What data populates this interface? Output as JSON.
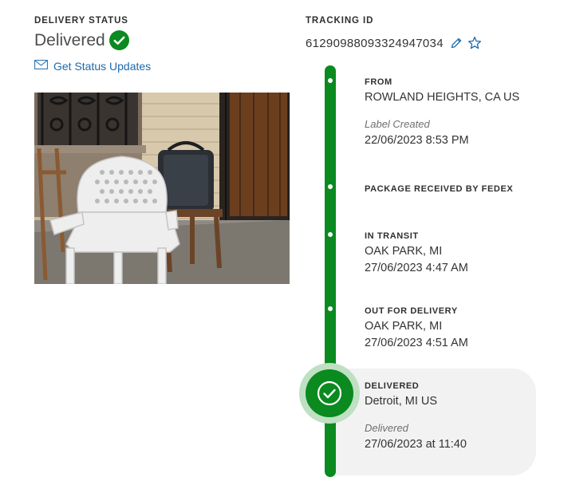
{
  "delivery_status": {
    "heading": "DELIVERY STATUS",
    "status": "Delivered",
    "updates_link": "Get Status Updates"
  },
  "tracking": {
    "heading": "TRACKING ID",
    "number": "61290988093324947034"
  },
  "timeline": {
    "from": {
      "title": "FROM",
      "location": "ROWLAND HEIGHTS, CA US",
      "note": "Label Created",
      "datetime": "22/06/2023 8:53 PM"
    },
    "received": {
      "title": "PACKAGE RECEIVED BY FEDEX"
    },
    "in_transit": {
      "title": "IN TRANSIT",
      "location": "OAK PARK, MI",
      "datetime": "27/06/2023 4:47 AM"
    },
    "out_for_delivery": {
      "title": "OUT FOR DELIVERY",
      "location": "OAK PARK, MI",
      "datetime": "27/06/2023 4:51 AM"
    },
    "delivered": {
      "title": "DELIVERED",
      "location": "Detroit, MI US",
      "note": "Delivered",
      "datetime": "27/06/2023 at 11:40"
    }
  },
  "colors": {
    "brand_green": "#0a8a1f",
    "link_blue": "#1d6aab"
  }
}
